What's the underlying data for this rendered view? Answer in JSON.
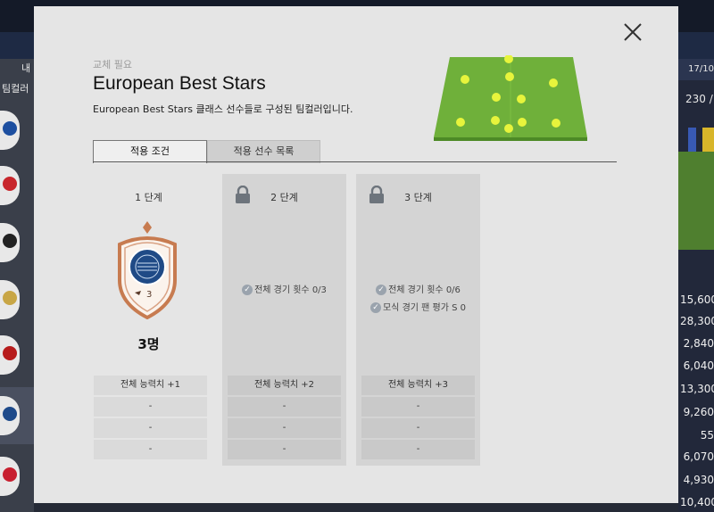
{
  "background": {
    "left_header_label": "내",
    "left_label": "팀컬러",
    "right_header": "17/10",
    "right_value": "230 /",
    "right_numbers": [
      "15,600",
      "28,300",
      "2,840",
      "6,040",
      "13,300",
      "9,260",
      "55",
      "6,070",
      "4,930",
      "10,400"
    ],
    "crest_colors": [
      "#1d4fa0",
      "#c8262c",
      "#222222",
      "#c8a646",
      "#b71c1c",
      "#1e4a8a",
      "#c82030"
    ]
  },
  "modal": {
    "kicker": "교체 필요",
    "title": "European Best Stars",
    "description": "European Best Stars 클래스 선수들로 구성된 팀컬러입니다.",
    "tabs": [
      {
        "label": "적용 조건",
        "active": true
      },
      {
        "label": "적용 선수 목록",
        "active": false
      }
    ],
    "stages": [
      {
        "label": "1 단계",
        "locked": false,
        "badge_level": "3",
        "count": "3명",
        "rows": [
          "전체 능력치 +1",
          "-",
          "-",
          "-"
        ]
      },
      {
        "label": "2 단계",
        "locked": true,
        "conditions": [
          "전체 경기 횟수 0/3"
        ],
        "rows": [
          "전체 능력치 +2",
          "-",
          "-",
          "-"
        ]
      },
      {
        "label": "3 단계",
        "locked": true,
        "conditions": [
          "전체 경기 횟수 0/6",
          "모식 경기 팬 평가 S 0"
        ],
        "rows": [
          "전체 능력치 +3",
          "-",
          "-",
          "-"
        ]
      }
    ],
    "colors": {
      "modal_bg": "#e5e5e5",
      "pitch": "#6fb03a",
      "player_dot": "#e7f43c",
      "badge_border": "#c77b50",
      "badge_inner": "#1f4a86"
    }
  }
}
